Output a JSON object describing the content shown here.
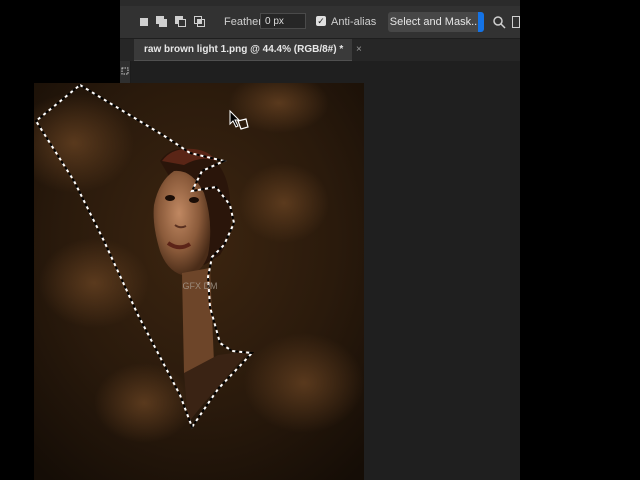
{
  "options_bar": {
    "feather_label": "Feather:",
    "feather_value": "0 px",
    "antialias_label": "Anti-alias",
    "antialias_checked": true,
    "select_and_mask_label": "Select and Mask..."
  },
  "document_tab": {
    "title": "raw brown light  1.png @ 44.4% (RGB/8#) *",
    "close_glyph": "×"
  },
  "canvas": {
    "watermark": "GFX DM"
  },
  "colors": {
    "accent": "#1473e6",
    "panel": "#323232",
    "workspace": "#1f1f1f",
    "backdrop": "#2a1a0c"
  },
  "icons": [
    "new-selection-icon",
    "add-selection-icon",
    "subtract-selection-icon",
    "intersect-selection-icon",
    "search-icon",
    "polygonal-lasso-cursor-icon",
    "checkmark-icon",
    "close-icon"
  ]
}
